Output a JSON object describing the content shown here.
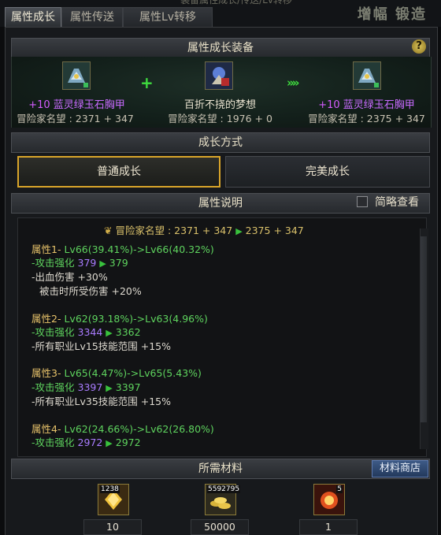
{
  "window": {
    "title_fragment": "装备属性成长/传送/Lv转移",
    "right_fragment": "增幅 锻造"
  },
  "tabs": [
    {
      "label": "属性成长",
      "active": true
    },
    {
      "label": "属性传送",
      "active": false
    },
    {
      "label": "属性Lv转移",
      "active": false
    }
  ],
  "equip_section": {
    "title": "属性成长装备",
    "help_label": "?",
    "source": {
      "plus": "+10",
      "name": "蓝灵绿玉石胸甲",
      "score": "冒险家名望 : 2371 + 347",
      "icon": "chestplate-icon"
    },
    "material": {
      "name": "百折不挠的梦想",
      "score": "冒险家名望 : 1976 + 0",
      "icon": "dream-item-icon"
    },
    "result": {
      "plus": "+10",
      "name": "蓝灵绿玉石胸甲",
      "score": "冒险家名望 : 2375 + 347",
      "icon": "chestplate-icon"
    },
    "plus_symbol": "+",
    "arrow_symbol": "»»"
  },
  "growth_section": {
    "title": "成长方式",
    "options": [
      {
        "label": "普通成长",
        "selected": true
      },
      {
        "label": "完美成长",
        "selected": false
      }
    ]
  },
  "attr_section": {
    "title": "属性说明",
    "brief_label": "简略查看",
    "brief_checked": false,
    "fame_line": {
      "label": "冒险家名望 : 2371 + 347",
      "arrow": "▶",
      "new": "2375 + 347"
    },
    "attributes": [
      {
        "title": "属性1-",
        "change": "Lv66(39.41%)->Lv66(40.32%)",
        "stat_label": "-攻击强化",
        "old": "379",
        "new": "379",
        "extra": [
          "-出血伤害 +30%",
          "被击时所受伤害 +20%"
        ]
      },
      {
        "title": "属性2-",
        "change": "Lv62(93.18%)->Lv63(4.96%)",
        "stat_label": "-攻击强化",
        "old": "3344",
        "new": "3362",
        "extra": [
          "-所有职业Lv15技能范围 +15%"
        ]
      },
      {
        "title": "属性3-",
        "change": "Lv65(4.47%)->Lv65(5.43%)",
        "stat_label": "-攻击强化",
        "old": "3397",
        "new": "3397",
        "extra": [
          "-所有职业Lv35技能范围 +15%"
        ]
      },
      {
        "title": "属性4-",
        "change": "Lv62(24.66%)->Lv62(26.80%)",
        "stat_label": "-攻击强化",
        "old": "2972",
        "new": "2972",
        "extra": []
      }
    ]
  },
  "materials_section": {
    "title": "所需材料",
    "shop_label": "材料商店",
    "items": [
      {
        "icon": "crystal-material-icon",
        "owned": "1238",
        "required": "10"
      },
      {
        "icon": "gold-coins-icon",
        "owned": "5592795",
        "required": "50000"
      },
      {
        "icon": "explosion-material-icon",
        "owned": "5",
        "required": "1"
      }
    ]
  },
  "colors": {
    "accent_gold": "#d9a52a",
    "green_text": "#5ed35e",
    "purple_value": "#a97cff",
    "plus_magenta": "#d55cff"
  }
}
